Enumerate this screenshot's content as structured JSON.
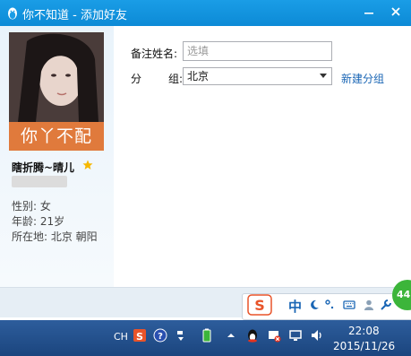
{
  "window": {
    "title": "你不知道 - 添加好友",
    "minimize_icon": "minimize-icon",
    "close_icon": "close-icon",
    "app_icon": "qq-penguin-icon",
    "accent_color": "#0c8ad6"
  },
  "profile": {
    "avatar_caption": "你丫不配",
    "nickname": "瞎折腾~晴儿",
    "gender": "性别: 女",
    "age": "年龄: 21岁",
    "location": "所在地: 北京  朝阳"
  },
  "form": {
    "remark_label": "备注姓名:",
    "remark_placeholder": "选填",
    "group_label_a": "分",
    "group_label_b": "组:",
    "group_selected": "北京",
    "new_group_link": "新建分组"
  },
  "ime": {
    "mode": "中"
  },
  "taskbar": {
    "lang": "CH",
    "time": "22:08",
    "date": "2015/11/26"
  },
  "badge": {
    "value": "44"
  }
}
